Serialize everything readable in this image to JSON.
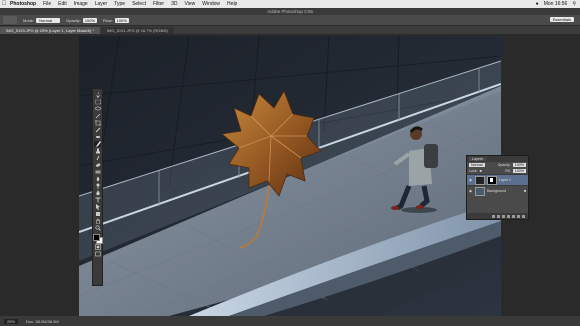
{
  "menubar": {
    "app": "Photoshop",
    "items": [
      "File",
      "Edit",
      "Image",
      "Layer",
      "Type",
      "Select",
      "Filter",
      "3D",
      "View",
      "Window",
      "Help"
    ],
    "clock": "Mon 16:56"
  },
  "window_title": "Adobe Photoshop CS6",
  "options": {
    "mode_label": "Mode:",
    "mode_value": "Normal",
    "opacity_label": "Opacity:",
    "opacity_value": "100%",
    "flow_label": "Flow:",
    "flow_value": "100%",
    "workspace": "Essentials"
  },
  "tabs": [
    {
      "label": "IMG_5193.JPG @ 25% (Layer 1, Layer Mask/8) *",
      "active": true
    },
    {
      "label": "IMG_5191.JPG @ 16.7% (RGB/8)",
      "active": false
    }
  ],
  "status": {
    "zoom": "25%",
    "doc": "Doc: 38.0M/38.0M"
  },
  "layers_panel": {
    "tab": "Layers",
    "kind": "Normal",
    "opacity_label": "Opacity:",
    "opacity": "100%",
    "lock_label": "Lock:",
    "fill_label": "Fill:",
    "fill": "100%",
    "layers": [
      {
        "name": "Layer 1",
        "selected": true
      },
      {
        "name": "Background",
        "selected": false
      }
    ]
  },
  "colors": {
    "foreground": "#000000",
    "background": "#ffffff",
    "selection": "#5b6f8f"
  }
}
